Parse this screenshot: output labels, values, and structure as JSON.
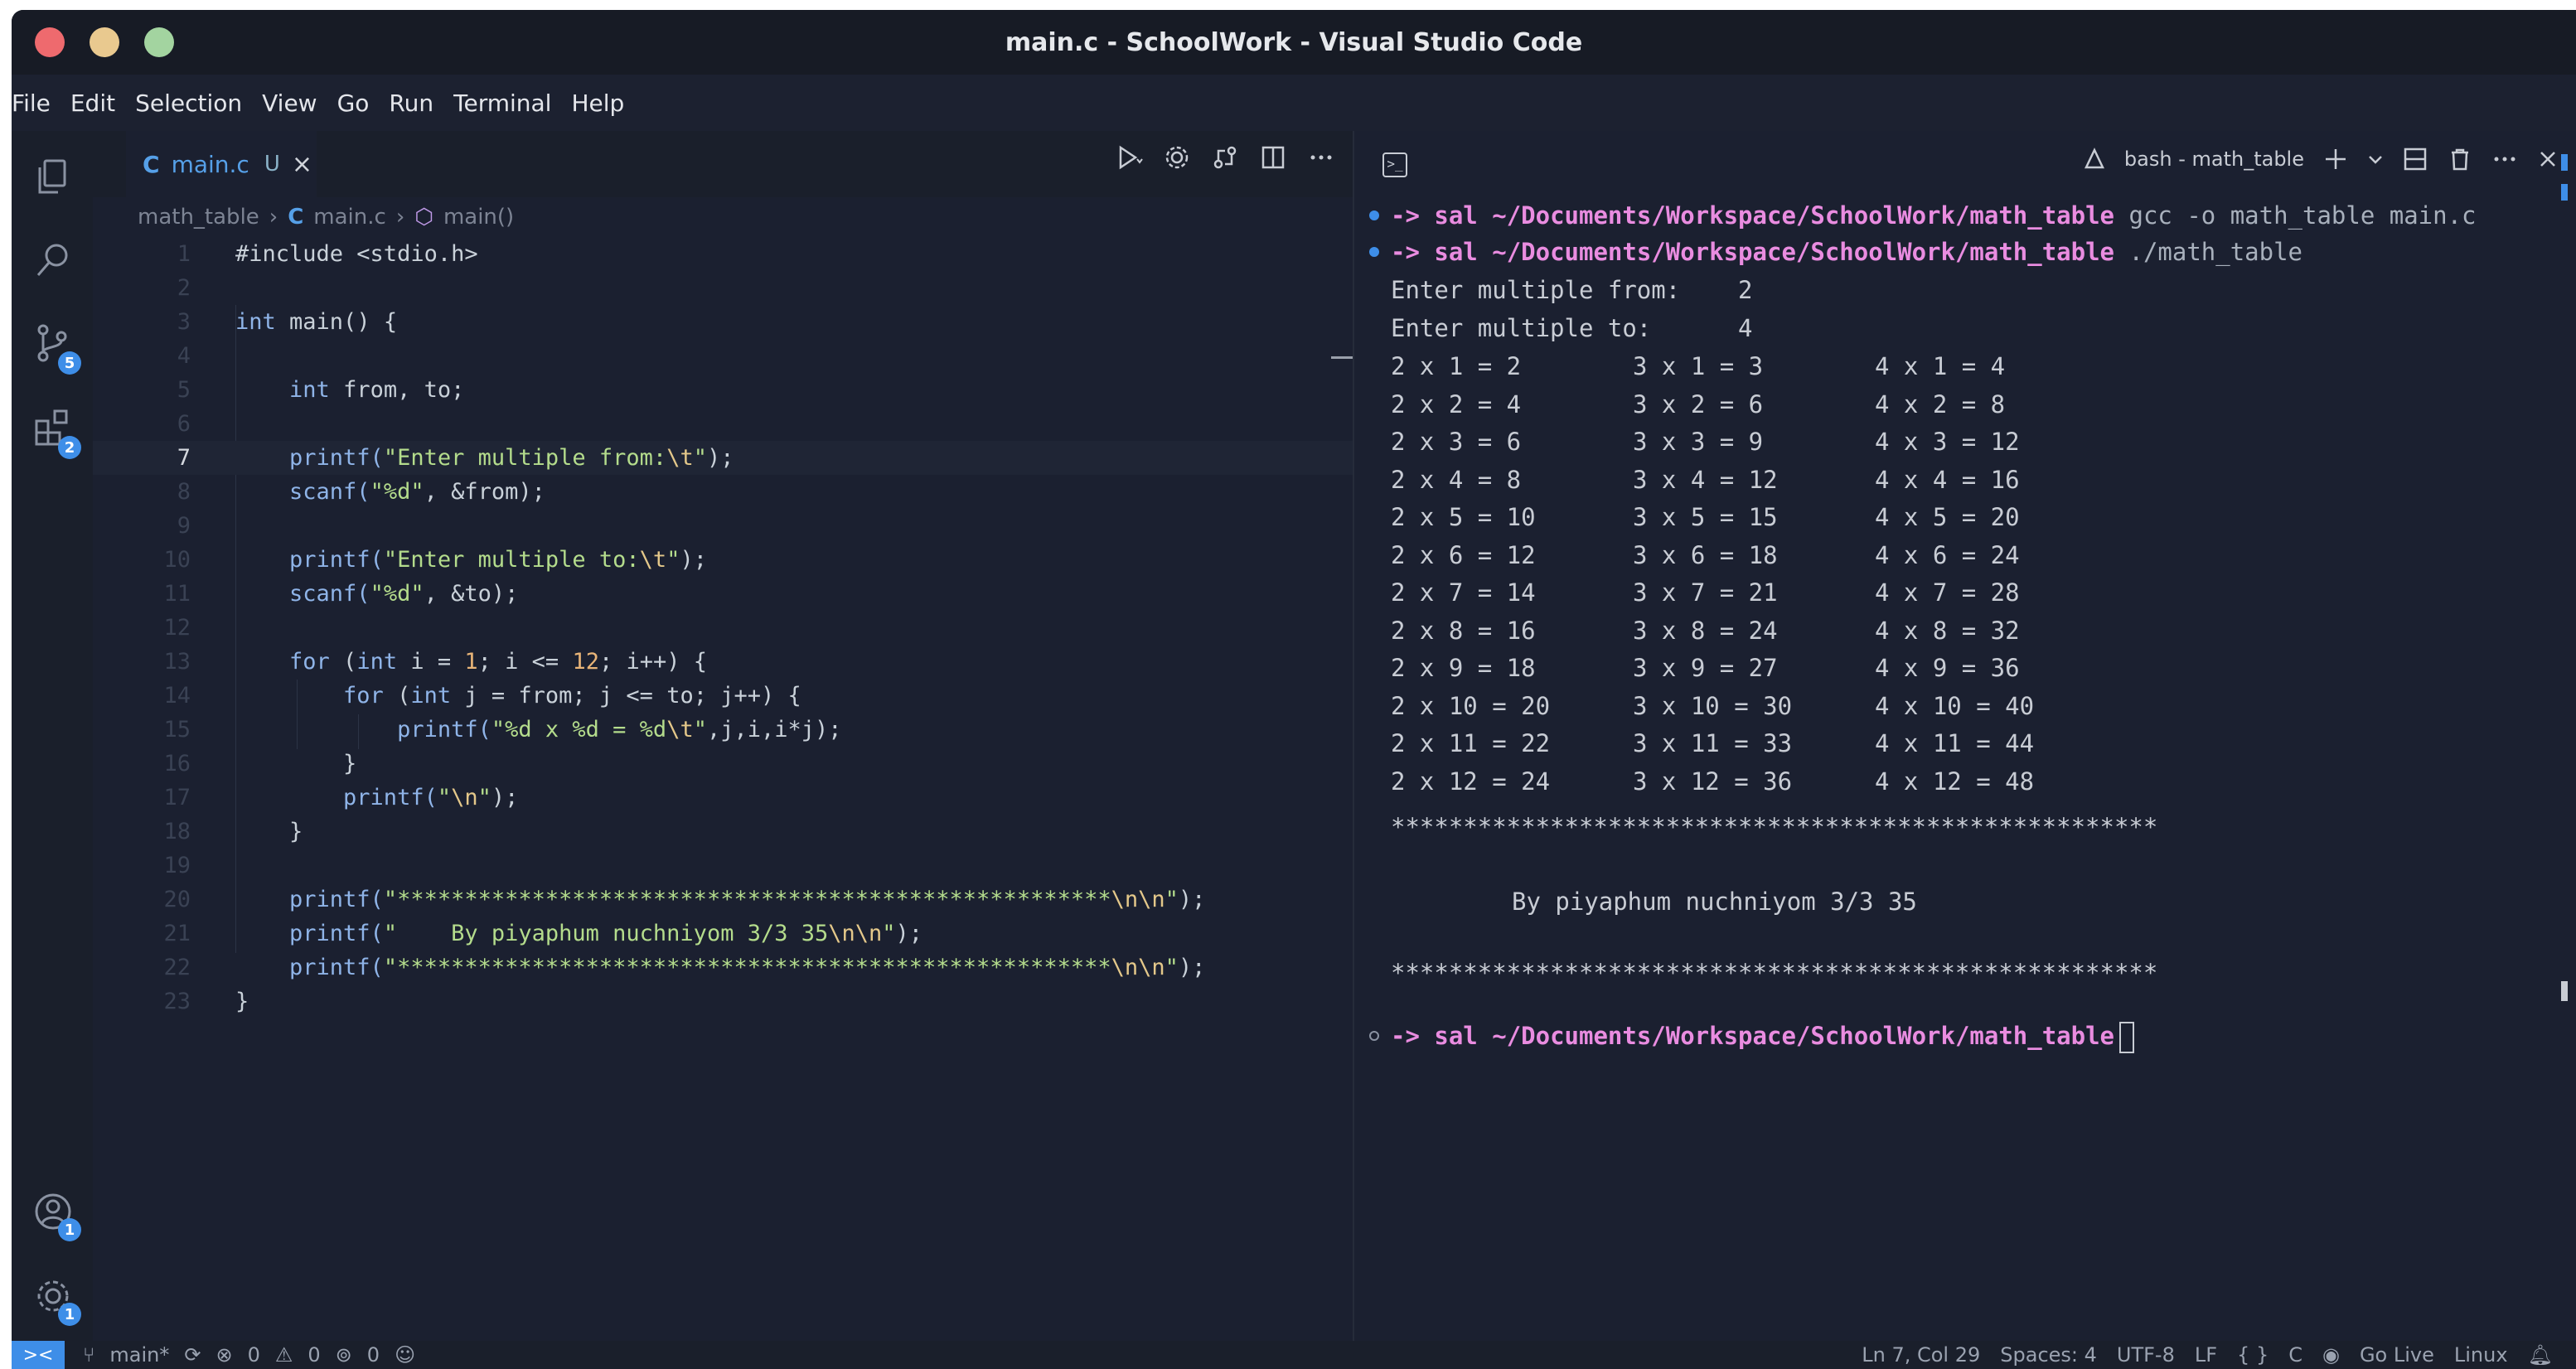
{
  "window": {
    "title": "main.c - SchoolWork - Visual Studio Code"
  },
  "menu": [
    "File",
    "Edit",
    "Selection",
    "View",
    "Go",
    "Run",
    "Terminal",
    "Help"
  ],
  "activity": {
    "source_control_badge": "5",
    "extensions_badge": "2",
    "accounts_badge": "1",
    "settings_badge": "1"
  },
  "editor": {
    "tab": {
      "icon_letter": "C",
      "name": "main.c",
      "status": "U",
      "close": "×"
    },
    "breadcrumb": [
      "math_table",
      "C",
      "main.c",
      "main()"
    ],
    "lines": [
      {
        "n": "1",
        "tokens": [
          {
            "t": "#include <stdio.h>",
            "c": "plain"
          }
        ]
      },
      {
        "n": "2",
        "tokens": []
      },
      {
        "n": "3",
        "tokens": [
          {
            "t": "int",
            "c": "kw"
          },
          {
            "t": " main() {",
            "c": "plain"
          }
        ]
      },
      {
        "n": "4",
        "tokens": []
      },
      {
        "n": "5",
        "tokens": [
          {
            "t": "    ",
            "c": "plain"
          },
          {
            "t": "int",
            "c": "kw"
          },
          {
            "t": " from, to;",
            "c": "plain"
          }
        ]
      },
      {
        "n": "6",
        "tokens": []
      },
      {
        "n": "7",
        "tokens": [
          {
            "t": "    printf(",
            "c": "kw"
          },
          {
            "t": "\"Enter multiple from:",
            "c": "str"
          },
          {
            "t": "\\t",
            "c": "esc"
          },
          {
            "t": "\"",
            "c": "str"
          },
          {
            "t": ");",
            "c": "plain"
          }
        ]
      },
      {
        "n": "8",
        "tokens": [
          {
            "t": "    scanf(",
            "c": "kw"
          },
          {
            "t": "\"%d\"",
            "c": "str"
          },
          {
            "t": ", &from);",
            "c": "plain"
          }
        ]
      },
      {
        "n": "9",
        "tokens": []
      },
      {
        "n": "10",
        "tokens": [
          {
            "t": "    printf(",
            "c": "kw"
          },
          {
            "t": "\"Enter multiple to:",
            "c": "str"
          },
          {
            "t": "\\t",
            "c": "esc"
          },
          {
            "t": "\"",
            "c": "str"
          },
          {
            "t": ");",
            "c": "plain"
          }
        ]
      },
      {
        "n": "11",
        "tokens": [
          {
            "t": "    scanf(",
            "c": "kw"
          },
          {
            "t": "\"%d\"",
            "c": "str"
          },
          {
            "t": ", &to);",
            "c": "plain"
          }
        ]
      },
      {
        "n": "12",
        "tokens": []
      },
      {
        "n": "13",
        "tokens": [
          {
            "t": "    for",
            "c": "kw"
          },
          {
            "t": " (",
            "c": "plain"
          },
          {
            "t": "int",
            "c": "kw"
          },
          {
            "t": " i = ",
            "c": "plain"
          },
          {
            "t": "1",
            "c": "num"
          },
          {
            "t": "; i <= ",
            "c": "plain"
          },
          {
            "t": "12",
            "c": "num"
          },
          {
            "t": "; i++) {",
            "c": "plain"
          }
        ]
      },
      {
        "n": "14",
        "tokens": [
          {
            "t": "        for",
            "c": "kw"
          },
          {
            "t": " (",
            "c": "plain"
          },
          {
            "t": "int",
            "c": "kw"
          },
          {
            "t": " j = from; j <= to; j++) {",
            "c": "plain"
          }
        ]
      },
      {
        "n": "15",
        "tokens": [
          {
            "t": "            printf(",
            "c": "kw"
          },
          {
            "t": "\"%d x %d = %d",
            "c": "str"
          },
          {
            "t": "\\t",
            "c": "esc"
          },
          {
            "t": "\"",
            "c": "str"
          },
          {
            "t": ",j,i,i*j);",
            "c": "plain"
          }
        ]
      },
      {
        "n": "16",
        "tokens": [
          {
            "t": "        }",
            "c": "plain"
          }
        ]
      },
      {
        "n": "17",
        "tokens": [
          {
            "t": "        printf(",
            "c": "kw"
          },
          {
            "t": "\"",
            "c": "str"
          },
          {
            "t": "\\n",
            "c": "esc"
          },
          {
            "t": "\"",
            "c": "str"
          },
          {
            "t": ");",
            "c": "plain"
          }
        ]
      },
      {
        "n": "18",
        "tokens": [
          {
            "t": "    }",
            "c": "plain"
          }
        ]
      },
      {
        "n": "19",
        "tokens": []
      },
      {
        "n": "20",
        "tokens": [
          {
            "t": "    printf(",
            "c": "kw"
          },
          {
            "t": "\"*****************************************************",
            "c": "str"
          },
          {
            "t": "\\n\\n",
            "c": "esc"
          },
          {
            "t": "\"",
            "c": "str"
          },
          {
            "t": ");",
            "c": "plain"
          }
        ]
      },
      {
        "n": "21",
        "tokens": [
          {
            "t": "    printf(",
            "c": "kw"
          },
          {
            "t": "\"    By piyaphum nuchniyom 3/3 35",
            "c": "str"
          },
          {
            "t": "\\n\\n",
            "c": "esc"
          },
          {
            "t": "\"",
            "c": "str"
          },
          {
            "t": ");",
            "c": "plain"
          }
        ]
      },
      {
        "n": "22",
        "tokens": [
          {
            "t": "    printf(",
            "c": "kw"
          },
          {
            "t": "\"*****************************************************",
            "c": "str"
          },
          {
            "t": "\\n\\n",
            "c": "esc"
          },
          {
            "t": "\"",
            "c": "str"
          },
          {
            "t": ");",
            "c": "plain"
          }
        ]
      },
      {
        "n": "23",
        "tokens": [
          {
            "t": "}",
            "c": "plain"
          }
        ]
      }
    ],
    "active_line": "7"
  },
  "terminal": {
    "shell_name": "bash - math_table",
    "prompt": {
      "arrow": "->",
      "user": "sal",
      "path": "~/Documents/Workspace/SchoolWork/math_table"
    },
    "commands": [
      "gcc -o math_table main.c",
      "./math_table"
    ],
    "inputs": [
      {
        "label": "Enter multiple from:",
        "value": "2"
      },
      {
        "label": "Enter multiple to:",
        "value": "4"
      }
    ],
    "table": [
      [
        "2 x 1 = 2",
        "3 x 1 = 3",
        "4 x 1 = 4"
      ],
      [
        "2 x 2 = 4",
        "3 x 2 = 6",
        "4 x 2 = 8"
      ],
      [
        "2 x 3 = 6",
        "3 x 3 = 9",
        "4 x 3 = 12"
      ],
      [
        "2 x 4 = 8",
        "3 x 4 = 12",
        "4 x 4 = 16"
      ],
      [
        "2 x 5 = 10",
        "3 x 5 = 15",
        "4 x 5 = 20"
      ],
      [
        "2 x 6 = 12",
        "3 x 6 = 18",
        "4 x 6 = 24"
      ],
      [
        "2 x 7 = 14",
        "3 x 7 = 21",
        "4 x 7 = 28"
      ],
      [
        "2 x 8 = 16",
        "3 x 8 = 24",
        "4 x 8 = 32"
      ],
      [
        "2 x 9 = 18",
        "3 x 9 = 27",
        "4 x 9 = 36"
      ],
      [
        "2 x 10 = 20",
        "3 x 10 = 30",
        "4 x 10 = 40"
      ],
      [
        "2 x 11 = 22",
        "3 x 11 = 33",
        "4 x 11 = 44"
      ],
      [
        "2 x 12 = 24",
        "3 x 12 = 36",
        "4 x 12 = 48"
      ]
    ],
    "stars": "*****************************************************",
    "author": "By piyaphum nuchniyom 3/3 35"
  },
  "status": {
    "remote": "><",
    "branch": "main*",
    "errors": "0",
    "warnings": "0",
    "ports": "0",
    "position": "Ln 7, Col 29",
    "spaces": "Spaces: 4",
    "encoding": "UTF-8",
    "eol": "LF",
    "language": "C",
    "golive": "Go Live",
    "os": "Linux"
  }
}
